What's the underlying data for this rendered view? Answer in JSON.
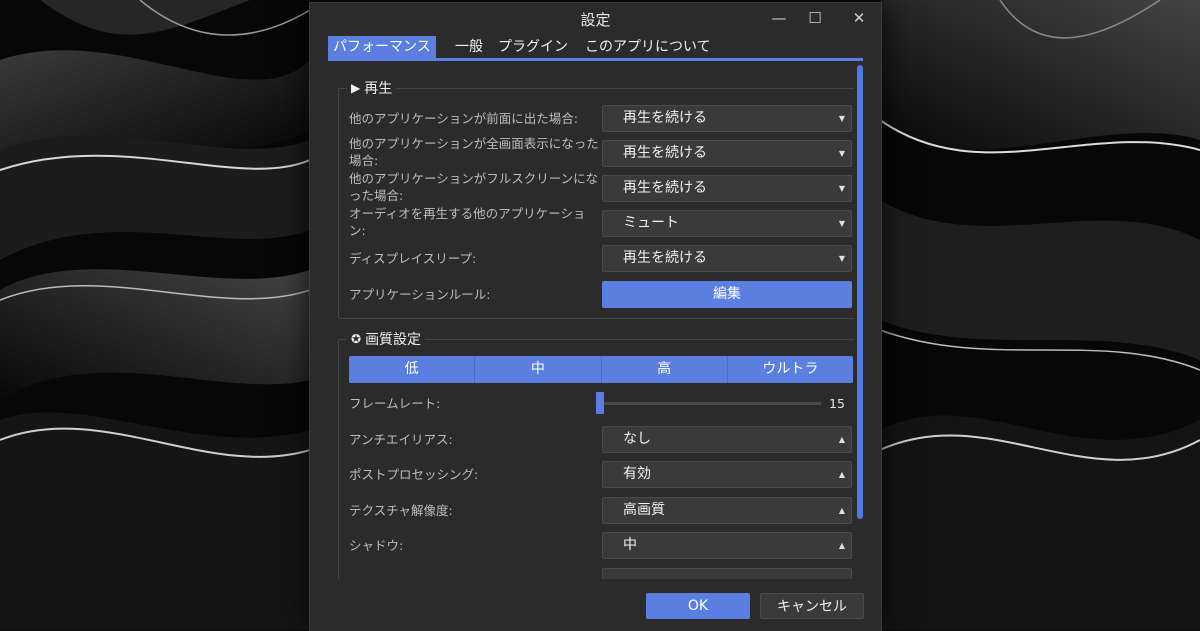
{
  "window": {
    "title": "設定",
    "minimize_icon": "minimize-icon",
    "maximize_icon": "maximize-icon",
    "close_icon": "close-icon"
  },
  "tabs": [
    {
      "label": "パフォーマンス",
      "active": true
    },
    {
      "label": "一般",
      "active": false
    },
    {
      "label": "プラグイン",
      "active": false
    },
    {
      "label": "このアプリについて",
      "active": false
    }
  ],
  "playback": {
    "title": "再生",
    "icon": "play-icon",
    "rows": [
      {
        "label": "他のアプリケーションが前面に出た場合:",
        "value": "再生を続ける"
      },
      {
        "label": "他のアプリケーションが全画面表示になった場合:",
        "value": "再生を続ける"
      },
      {
        "label": "他のアプリケーションがフルスクリーンになった場合:",
        "value": "再生を続ける"
      },
      {
        "label": "オーディオを再生する他のアプリケーション:",
        "value": "ミュート"
      },
      {
        "label": "ディスプレイスリープ:",
        "value": "再生を続ける"
      }
    ],
    "app_rules_label": "アプリケーションルール:",
    "edit_button": "編集"
  },
  "quality": {
    "title": "画質設定",
    "icon": "ribbon-icon",
    "presets": [
      "低",
      "中",
      "高",
      "ウルトラ"
    ],
    "framerate_label": "フレームレート:",
    "framerate_value": "15",
    "framerate_fraction": 0.0,
    "rows": [
      {
        "label": "アンチエイリアス:",
        "value": "なし"
      },
      {
        "label": "ポストプロセッシング:",
        "value": "有効"
      },
      {
        "label": "テクスチャ解像度:",
        "value": "高画質"
      },
      {
        "label": "シャドウ:",
        "value": "中"
      }
    ]
  },
  "footer": {
    "ok": "OK",
    "cancel": "キャンセル"
  },
  "colors": {
    "accent": "#5b7fe0",
    "window_bg": "#2b2b2b",
    "control_bg": "#3a3a3a"
  }
}
